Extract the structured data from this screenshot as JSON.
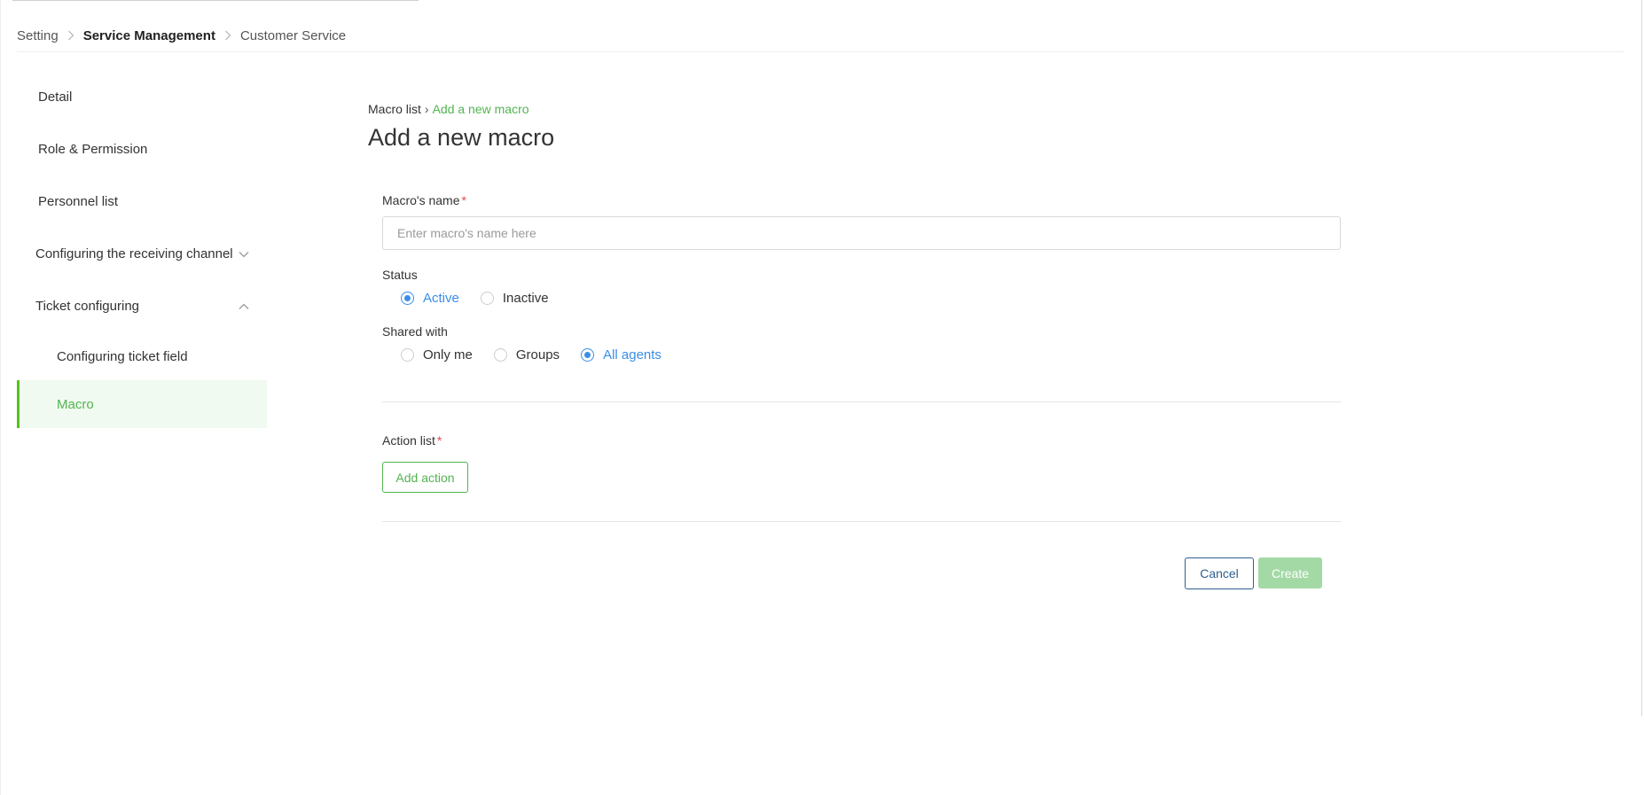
{
  "breadcrumb": {
    "items": [
      "Setting",
      "Service Management",
      "Customer Service"
    ],
    "active_index": 1
  },
  "sidebar": {
    "items": [
      {
        "label": "Detail"
      },
      {
        "label": "Role & Permission"
      },
      {
        "label": "Personnel list"
      },
      {
        "label": "Configuring the receiving channel",
        "expanded": false
      },
      {
        "label": "Ticket configuring",
        "expanded": true
      },
      {
        "label": "Configuring ticket field"
      },
      {
        "label": "Macro",
        "selected": true
      }
    ]
  },
  "content": {
    "breadcrumb": {
      "parent": "Macro list",
      "separator": "›",
      "current": "Add a new macro"
    },
    "title": "Add a new macro"
  },
  "form": {
    "name": {
      "label": "Macro's name",
      "required_mark": "*",
      "value": "",
      "placeholder": "Enter macro's name here"
    },
    "status": {
      "label": "Status",
      "options": [
        "Active",
        "Inactive"
      ],
      "selected": "Active"
    },
    "shared_with": {
      "label": "Shared with",
      "options": [
        "Only me",
        "Groups",
        "All agents"
      ],
      "selected": "All agents"
    },
    "action_list": {
      "label": "Action list",
      "required_mark": "*",
      "add_button": "Add action"
    }
  },
  "footer": {
    "cancel_label": "Cancel",
    "create_label": "Create"
  },
  "colors": {
    "accent_green": "#52b452",
    "radio_blue": "#3a8ee6",
    "required_red": "#e84545",
    "create_disabled": "#a3d9a5",
    "cancel_blue": "#2f5f8f"
  },
  "icons": {
    "breadcrumb_separator": "chevron-right-icon",
    "collapsed": "chevron-down-icon",
    "expanded": "chevron-up-icon"
  }
}
